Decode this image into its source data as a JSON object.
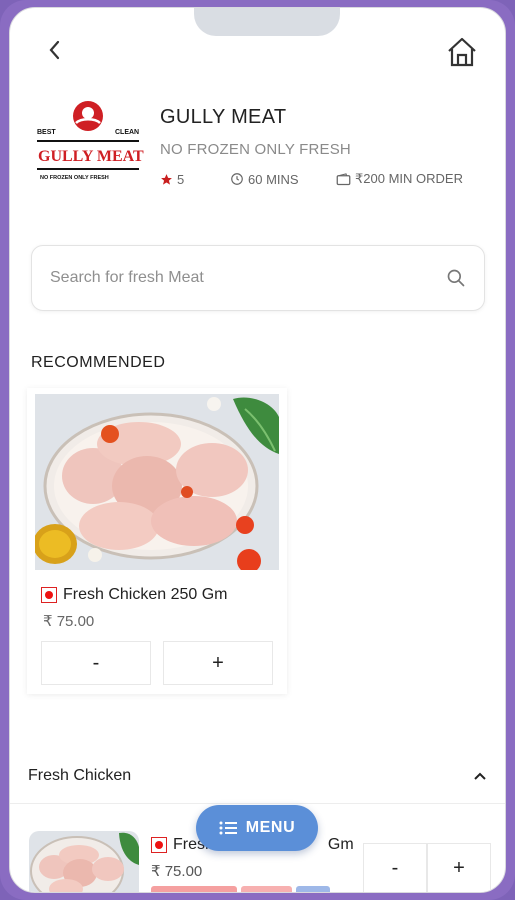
{
  "header": {
    "back_icon": "chevron-left-icon",
    "home_icon": "home-icon"
  },
  "shop": {
    "logo_top_left": "BEST",
    "logo_top_right": "CLEAN",
    "logo_name": "GULLY MEAT",
    "logo_tagline": "NO FROZEN ONLY FRESH",
    "name": "GULLY MEAT",
    "tagline": "NO FROZEN ONLY FRESH",
    "rating": "5",
    "delivery_time": "60 MINS",
    "min_order": "₹200 MIN ORDER",
    "rating_color": "#c91f1f"
  },
  "search": {
    "placeholder": "Search for fresh Meat"
  },
  "recommended": {
    "title": "RECOMMENDED",
    "items": [
      {
        "name": "Fresh Chicken 250 Gm",
        "price": "₹ 75.00",
        "minus": "-",
        "plus": "+"
      }
    ]
  },
  "category": {
    "title": "Fresh Chicken",
    "items": [
      {
        "name_visible": "Fresh",
        "name_suffix": "Gm",
        "price": "₹ 75.00",
        "minus": "-",
        "plus": "+"
      }
    ]
  },
  "menu_button": {
    "label": "MENU",
    "color": "#5b8fd8"
  }
}
